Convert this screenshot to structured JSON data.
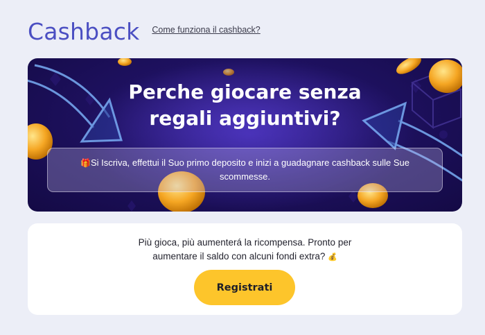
{
  "header": {
    "title": "Cashback",
    "how_link": "Come funziona il cashback?"
  },
  "banner": {
    "title": "Perche giocare senza regali aggiuntivi?",
    "info_icon": "gift-icon",
    "info_text": "Si Iscriva, effettui il Suo primo deposito e inizi a guadagnare cashback sulle Sue scommesse."
  },
  "card": {
    "text": "Più gioca, più aumenterá la ricompensa. Pronto per aumentare il saldo con alcuni fondi extra?",
    "text_icon": "money-bag-icon",
    "button_label": "Registrati"
  },
  "colors": {
    "background": "#eceef7",
    "title": "#4b4fc2",
    "banner_bg": "#1e1160",
    "button": "#fdc52b"
  }
}
